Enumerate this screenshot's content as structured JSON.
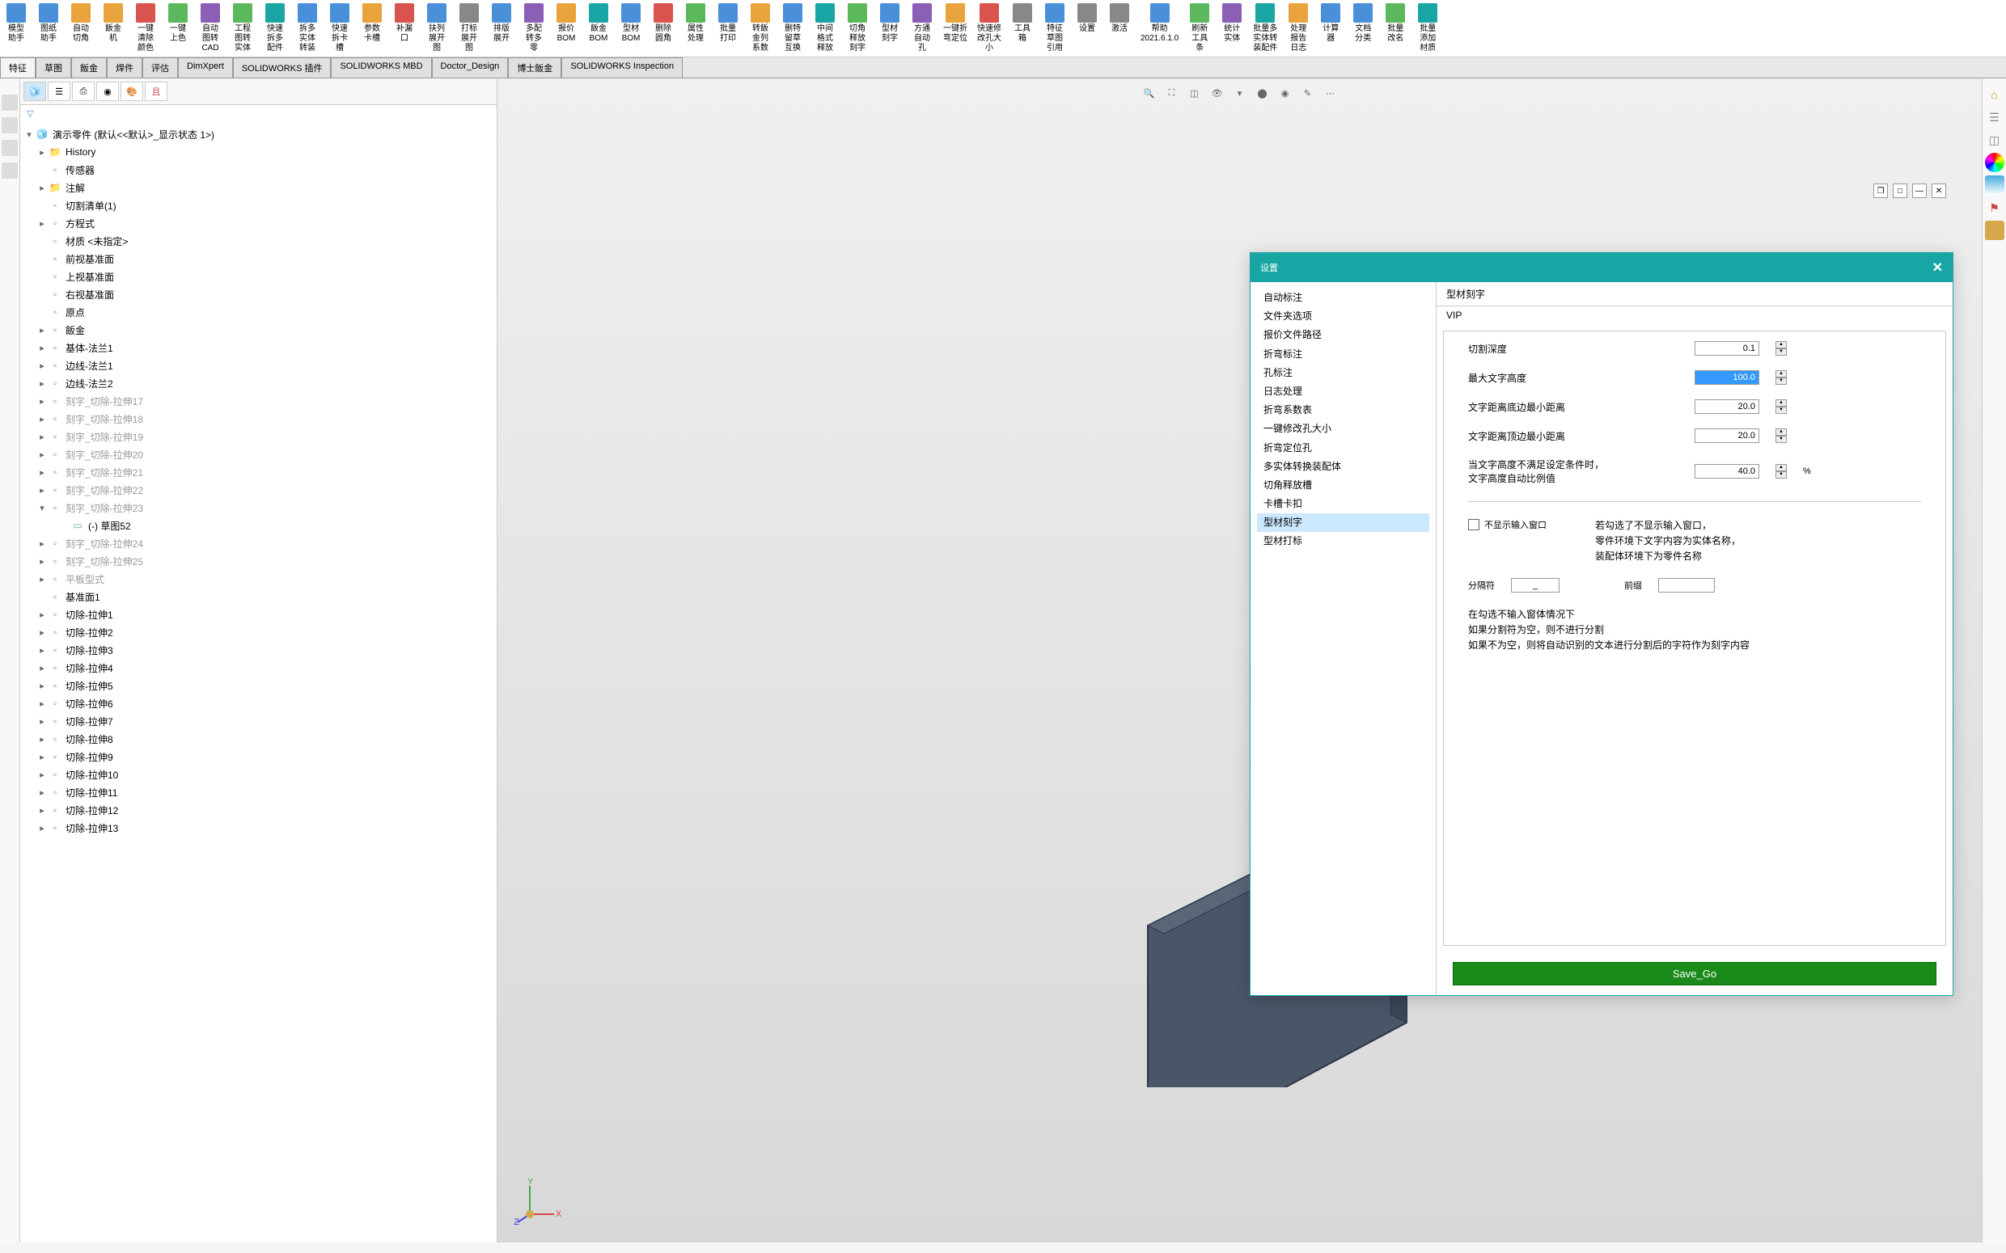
{
  "ribbon": [
    {
      "label": "模型\n助手",
      "cls": "ic-blue"
    },
    {
      "label": "图纸\n助手",
      "cls": "ic-blue"
    },
    {
      "label": "自动\n切角",
      "cls": "ic-orange"
    },
    {
      "label": "飯金\n机",
      "cls": "ic-orange"
    },
    {
      "label": "一键\n清除\n颜色",
      "cls": "ic-red"
    },
    {
      "label": "一键\n上色",
      "cls": "ic-green"
    },
    {
      "label": "自动\n图转\nCAD",
      "cls": "ic-purple"
    },
    {
      "label": "工程\n图转\n实体",
      "cls": "ic-green"
    },
    {
      "label": "快速\n拆多\n配件",
      "cls": "ic-teal"
    },
    {
      "label": "拆多\n实体\n转装",
      "cls": "ic-blue"
    },
    {
      "label": "快速\n拆卡\n槽",
      "cls": "ic-blue"
    },
    {
      "label": "参数\n卡槽",
      "cls": "ic-orange"
    },
    {
      "label": "补漏\n口",
      "cls": "ic-red"
    },
    {
      "label": "扶列\n展开\n图",
      "cls": "ic-blue"
    },
    {
      "label": "打标\n展开\n图",
      "cls": "ic-gray"
    },
    {
      "label": "排版\n展开",
      "cls": "ic-blue"
    },
    {
      "label": "多配\n转多\n零",
      "cls": "ic-purple"
    },
    {
      "label": "报价\nBOM",
      "cls": "ic-orange"
    },
    {
      "label": "飯金\nBOM",
      "cls": "ic-teal"
    },
    {
      "label": "型材\nBOM",
      "cls": "ic-blue"
    },
    {
      "label": "删除\n圆角",
      "cls": "ic-red"
    },
    {
      "label": "属性\n处理",
      "cls": "ic-green"
    },
    {
      "label": "批量\n打印",
      "cls": "ic-blue"
    },
    {
      "label": "转飯\n金列\n系数",
      "cls": "ic-orange"
    },
    {
      "label": "删特\n留草\n互换",
      "cls": "ic-blue"
    },
    {
      "label": "中间\n格式\n释放",
      "cls": "ic-teal"
    },
    {
      "label": "切角\n释放\n刻字",
      "cls": "ic-green"
    },
    {
      "label": "型材\n刻字",
      "cls": "ic-blue"
    },
    {
      "label": "方通\n自动\n孔",
      "cls": "ic-purple"
    },
    {
      "label": "一键折\n弯定位",
      "cls": "ic-orange"
    },
    {
      "label": "快速修\n改孔大\n小",
      "cls": "ic-red"
    },
    {
      "label": "工具\n箱",
      "cls": "ic-gray"
    },
    {
      "label": "特征\n草图\n引用",
      "cls": "ic-blue"
    },
    {
      "label": "设置",
      "cls": "ic-gray"
    },
    {
      "label": "激活",
      "cls": "ic-gray"
    },
    {
      "label": "帮助\n2021.6.1.0",
      "cls": "ic-blue"
    },
    {
      "label": "刷新\n工具\n条",
      "cls": "ic-green"
    },
    {
      "label": "统计\n实体",
      "cls": "ic-purple"
    },
    {
      "label": "批量多\n实体转\n装配件",
      "cls": "ic-teal"
    },
    {
      "label": "处理\n报告\n日志",
      "cls": "ic-orange"
    },
    {
      "label": "计算\n器",
      "cls": "ic-blue"
    },
    {
      "label": "文档\n分类",
      "cls": "ic-blue"
    },
    {
      "label": "批量\n改名",
      "cls": "ic-green"
    },
    {
      "label": "批量\n添加\n材质",
      "cls": "ic-teal"
    }
  ],
  "tabs": [
    "特征",
    "草图",
    "飯金",
    "焊件",
    "评估",
    "DimXpert",
    "SOLIDWORKS 插件",
    "SOLIDWORKS MBD",
    "Doctor_Design",
    "博士飯金",
    "SOLIDWORKS Inspection"
  ],
  "tree": {
    "root": "演示零件  (默认<<默认>_显示状态 1>)",
    "items": [
      {
        "label": "History",
        "icon": "folder",
        "exp": true
      },
      {
        "label": "传感器",
        "icon": "feature",
        "exp": false
      },
      {
        "label": "注解",
        "icon": "folder",
        "exp": true
      },
      {
        "label": "切割清单(1)",
        "icon": "feature",
        "exp": false
      },
      {
        "label": "方程式",
        "icon": "feature",
        "exp": true
      },
      {
        "label": "材质 <未指定>",
        "icon": "feature",
        "exp": false
      },
      {
        "label": "前视基准面",
        "icon": "feature",
        "exp": false
      },
      {
        "label": "上视基准面",
        "icon": "feature",
        "exp": false
      },
      {
        "label": "右视基准面",
        "icon": "feature",
        "exp": false
      },
      {
        "label": "原点",
        "icon": "feature",
        "exp": false
      },
      {
        "label": "飯金",
        "icon": "feature",
        "exp": true
      },
      {
        "label": "基体-法兰1",
        "icon": "feature",
        "exp": true
      },
      {
        "label": "边线-法兰1",
        "icon": "feature",
        "exp": true
      },
      {
        "label": "边线-法兰2",
        "icon": "feature",
        "exp": true
      },
      {
        "label": "刻字_切除-拉伸17",
        "icon": "feature",
        "exp": true,
        "dim": true
      },
      {
        "label": "刻字_切除-拉伸18",
        "icon": "feature",
        "exp": true,
        "dim": true
      },
      {
        "label": "刻字_切除-拉伸19",
        "icon": "feature",
        "exp": true,
        "dim": true
      },
      {
        "label": "刻字_切除-拉伸20",
        "icon": "feature",
        "exp": true,
        "dim": true
      },
      {
        "label": "刻字_切除-拉伸21",
        "icon": "feature",
        "exp": true,
        "dim": true
      },
      {
        "label": "刻字_切除-拉伸22",
        "icon": "feature",
        "exp": true,
        "dim": true
      },
      {
        "label": "刻字_切除-拉伸23",
        "icon": "feature",
        "exp": true,
        "dim": true,
        "open": true
      },
      {
        "label": "(-) 草图52",
        "icon": "sketch",
        "exp": false,
        "indent": 1
      },
      {
        "label": "刻字_切除-拉伸24",
        "icon": "feature",
        "exp": true,
        "dim": true
      },
      {
        "label": "刻字_切除-拉伸25",
        "icon": "feature",
        "exp": true,
        "dim": true
      },
      {
        "label": "平板型式",
        "icon": "feature",
        "exp": true,
        "dim": true
      },
      {
        "label": "基准面1",
        "icon": "feature",
        "exp": false
      },
      {
        "label": "切除-拉伸1",
        "icon": "feature",
        "exp": true
      },
      {
        "label": "切除-拉伸2",
        "icon": "feature",
        "exp": true
      },
      {
        "label": "切除-拉伸3",
        "icon": "feature",
        "exp": true
      },
      {
        "label": "切除-拉伸4",
        "icon": "feature",
        "exp": true
      },
      {
        "label": "切除-拉伸5",
        "icon": "feature",
        "exp": true
      },
      {
        "label": "切除-拉伸6",
        "icon": "feature",
        "exp": true
      },
      {
        "label": "切除-拉伸7",
        "icon": "feature",
        "exp": true
      },
      {
        "label": "切除-拉伸8",
        "icon": "feature",
        "exp": true
      },
      {
        "label": "切除-拉伸9",
        "icon": "feature",
        "exp": true
      },
      {
        "label": "切除-拉伸10",
        "icon": "feature",
        "exp": true
      },
      {
        "label": "切除-拉伸11",
        "icon": "feature",
        "exp": true
      },
      {
        "label": "切除-拉伸12",
        "icon": "feature",
        "exp": true
      },
      {
        "label": "切除-拉伸13",
        "icon": "feature",
        "exp": true
      }
    ]
  },
  "dialog": {
    "title": "设置",
    "nav": [
      "自动标注",
      "文件夹选项",
      "报价文件路径",
      "折弯标注",
      "孔标注",
      "日志处理",
      "折弯系数表",
      "一键修改孔大小",
      "折弯定位孔",
      "多实体转换装配体",
      "切角释放槽",
      "卡槽卡扣",
      "型材刻字",
      "型材打标"
    ],
    "nav_active": "型材刻字",
    "header": "型材刻字",
    "vip": "VIP",
    "fields": {
      "cut_depth_label": "切割深度",
      "cut_depth_value": "0.1",
      "max_height_label": "最大文字高度",
      "max_height_value": "100.0",
      "bottom_dist_label": "文字距离底边最小距离",
      "bottom_dist_value": "20.0",
      "top_dist_label": "文字距离顶边最小距离",
      "top_dist_value": "20.0",
      "ratio_label": "当文字高度不满足设定条件时，\n文字高度自动比例值",
      "ratio_value": "40.0",
      "ratio_unit": "%",
      "no_input_label": "不显示输入窗口",
      "hint1": "若勾选了不显示输入窗口，\n零件环境下文字内容为实体名称，\n装配体环境下为零件名称",
      "separator_label": "分隔符",
      "separator_value": "_",
      "prefix_label": "前缀",
      "prefix_value": "",
      "hint2": "在勾选不输入窗体情况下\n如果分割符为空，则不进行分割\n如果不为空，则将自动识别的文本进行分割后的字符作为刻字内容"
    },
    "save_btn": "Save_Go"
  },
  "triad": {
    "x": "X",
    "y": "Y",
    "z": "Z"
  }
}
